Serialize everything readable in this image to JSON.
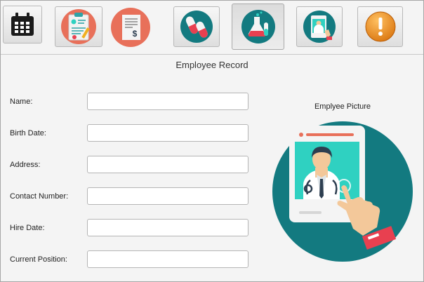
{
  "toolbar": {
    "buttons": [
      {
        "name": "calendar-button",
        "icon": "calendar-icon"
      },
      {
        "name": "medical-report-button",
        "icon": "clipboard-report-icon"
      },
      {
        "name": "billing-button",
        "icon": "invoice-dollar-icon"
      },
      {
        "name": "pharmacy-button",
        "icon": "pills-icon"
      },
      {
        "name": "laboratory-button",
        "icon": "lab-flasks-icon"
      },
      {
        "name": "employee-button",
        "icon": "doctor-tablet-icon"
      },
      {
        "name": "alert-button",
        "icon": "exclamation-icon"
      }
    ]
  },
  "form": {
    "title": "Employee Record",
    "fields": [
      {
        "label": "Name:",
        "value": "",
        "placeholder": ""
      },
      {
        "label": "Birth Date:",
        "value": "",
        "placeholder": ""
      },
      {
        "label": "Address:",
        "value": "",
        "placeholder": ""
      },
      {
        "label": "Contact Number:",
        "value": "",
        "placeholder": ""
      },
      {
        "label": "Hire Date:",
        "value": "",
        "placeholder": ""
      },
      {
        "label": "Current Position:",
        "value": "",
        "placeholder": ""
      }
    ]
  },
  "picture": {
    "label": "Emplyee Picture",
    "icon": "doctor-tablet-illustration"
  },
  "colors": {
    "teal": "#137a80",
    "aqua": "#2fd1c1",
    "coral": "#e8705a",
    "red": "#e84050",
    "orange": "#e8901e"
  }
}
